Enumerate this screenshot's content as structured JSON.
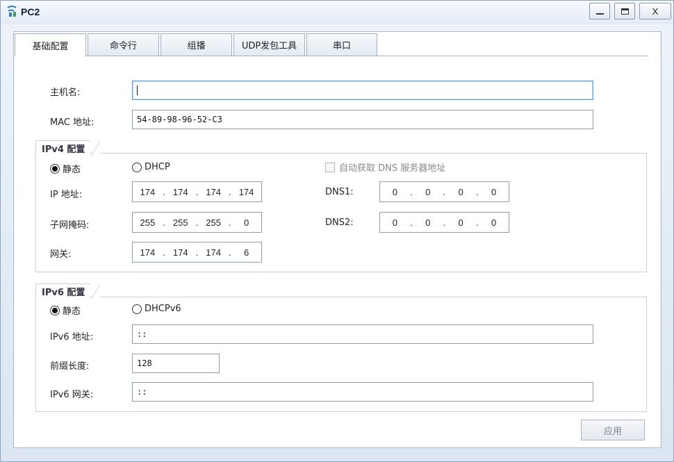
{
  "window": {
    "title": "PC2",
    "minimize_label": "",
    "maximize_label": "",
    "close_label": "X"
  },
  "tabs": [
    {
      "label": "基础配置",
      "active": true
    },
    {
      "label": "命令行",
      "active": false
    },
    {
      "label": "组播",
      "active": false
    },
    {
      "label": "UDP发包工具",
      "active": false
    },
    {
      "label": "串口",
      "active": false
    }
  ],
  "host": {
    "hostname_label": "主机名:",
    "hostname_value": "",
    "mac_label": "MAC 地址:",
    "mac_value": "54-89-98-96-52-C3"
  },
  "ipv4": {
    "group_title": "IPv4 配置",
    "static_label": "静态",
    "dhcp_label": "DHCP",
    "mode": "static",
    "auto_dns_label": "自动获取 DNS 服务器地址",
    "auto_dns_checked": false,
    "ip_label": "IP 地址:",
    "ip": [
      "174",
      "174",
      "174",
      "174"
    ],
    "mask_label": "子网掩码:",
    "mask": [
      "255",
      "255",
      "255",
      "0"
    ],
    "gateway_label": "网关:",
    "gateway": [
      "174",
      "174",
      "174",
      "6"
    ],
    "dns1_label": "DNS1:",
    "dns1": [
      "0",
      "0",
      "0",
      "0"
    ],
    "dns2_label": "DNS2:",
    "dns2": [
      "0",
      "0",
      "0",
      "0"
    ]
  },
  "ipv6": {
    "group_title": "IPv6 配置",
    "static_label": "静态",
    "dhcp_label": "DHCPv6",
    "mode": "static",
    "addr_label": "IPv6 地址:",
    "addr_value": "::",
    "prefix_label": "前缀长度:",
    "prefix_value": "128",
    "gw_label": "IPv6 网关:",
    "gw_value": "::"
  },
  "apply_label": "应用"
}
